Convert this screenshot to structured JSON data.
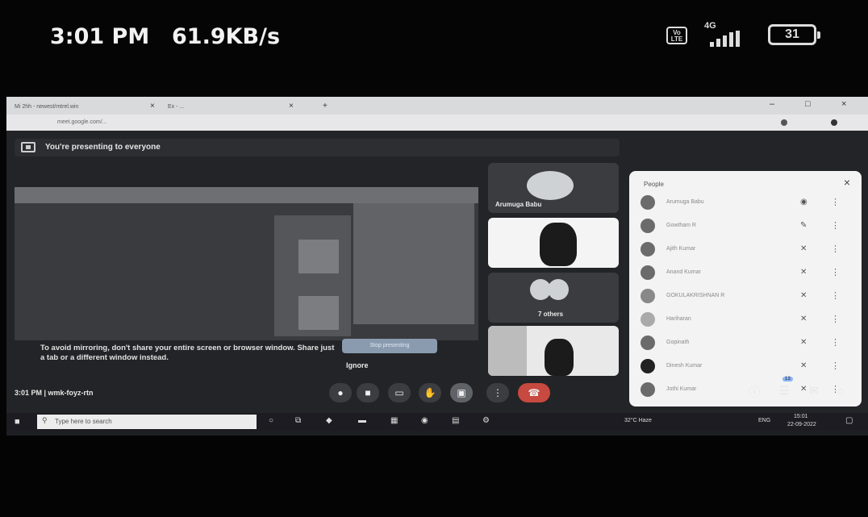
{
  "phone_status": {
    "time": "3:01 PM",
    "data_rate": "61.9KB/s",
    "volte": "Vo LTE",
    "network": "4G",
    "battery": "31",
    "icons": [
      "volte-icon",
      "signal-icon",
      "battery-icon"
    ]
  },
  "browser": {
    "tabs": [
      "Mi 2hh - newest/mtrel.win",
      "Ex - ..."
    ],
    "new_tab": "+",
    "address": "meet.google.com/...",
    "window_controls": [
      "–",
      "□",
      "×"
    ]
  },
  "meet": {
    "presenting_banner": "You're presenting to everyone",
    "warning_text": "To avoid mirroring, don't share your entire screen or browser window. Share just a tab or a different window instead.",
    "stop_presenting": "Stop presenting",
    "ignore": "Ignore",
    "tiles": [
      {
        "name": "Arumuga Babu"
      },
      {
        "name": ""
      },
      {
        "name": "7 others"
      },
      {
        "name": ""
      }
    ],
    "meeting_info": "3:01 PM  |  wmk-foyz-rtn",
    "controls": [
      "mic-icon",
      "camera-icon",
      "captions-icon",
      "raise-hand-icon",
      "present-icon",
      "more-options-icon",
      "leave-call-icon"
    ],
    "right_controls": [
      "info-icon",
      "people-icon",
      "chat-icon",
      "activities-icon"
    ],
    "people_count_badge": "13"
  },
  "people_panel": {
    "title": "People",
    "close": "×",
    "participants": [
      {
        "name": "Arumuga Babu"
      },
      {
        "name": "Gowtham R"
      },
      {
        "name": "Ajith Kumar"
      },
      {
        "name": "Anand Kumar"
      },
      {
        "name": "GOKULAKRISHNAN R"
      },
      {
        "name": "Hariharan"
      },
      {
        "name": "Gopinath"
      },
      {
        "name": "Dinesh Kumar"
      },
      {
        "name": "Jothi Kumar"
      }
    ]
  },
  "taskbar": {
    "search_placeholder": "Type here to search",
    "weather": "32°C Haze",
    "language": "ENG",
    "time": "15:01",
    "date": "22-09-2022"
  }
}
